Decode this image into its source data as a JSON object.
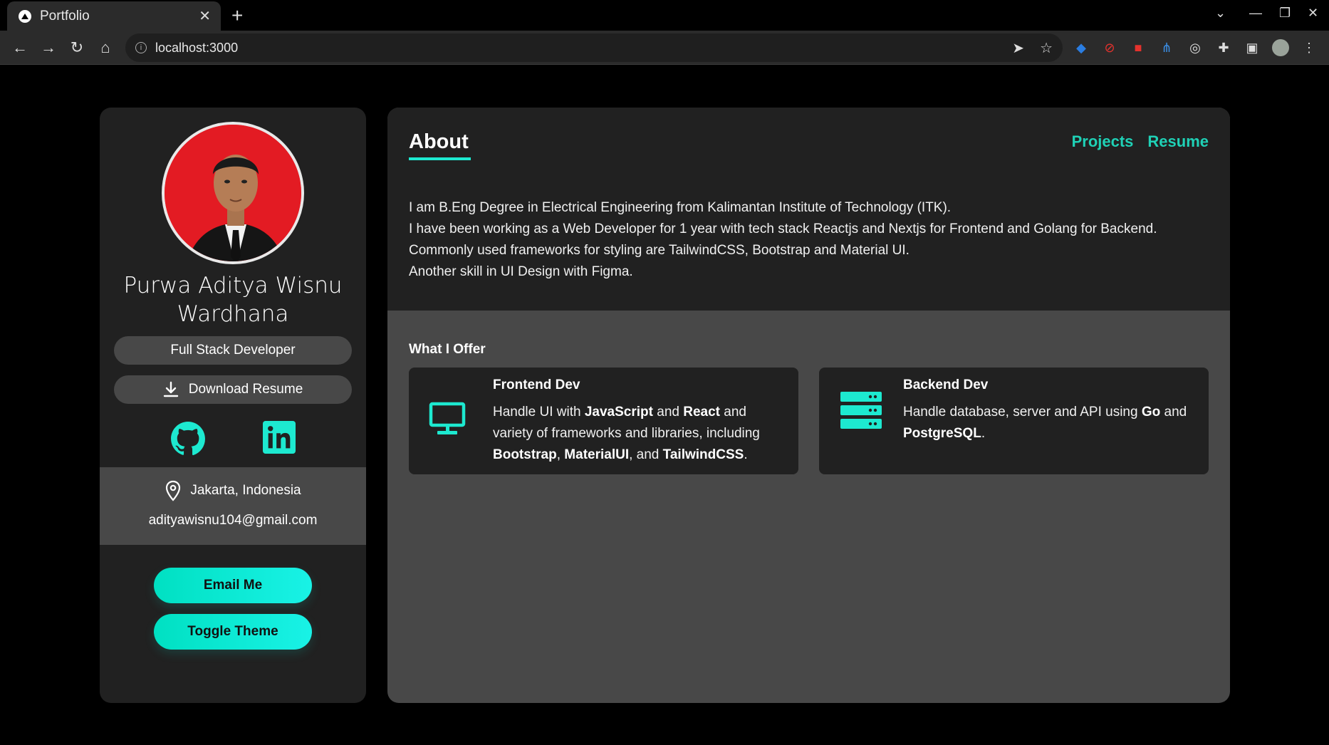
{
  "browser": {
    "tab_title": "Portfolio",
    "tab_close": "✕",
    "new_tab": "+",
    "url": "localhost:3000"
  },
  "profile": {
    "name": "Purwa Aditya Wisnu Wardhana",
    "role": "Full Stack Developer",
    "download_label": "Download Resume",
    "location": "Jakarta, Indonesia",
    "email": "adityawisnu104@gmail.com",
    "email_button": "Email Me",
    "theme_button": "Toggle Theme"
  },
  "nav": {
    "title": "About",
    "links": [
      "Projects",
      "Resume"
    ]
  },
  "about": {
    "lines": [
      "I am B.Eng Degree in Electrical Engineering from Kalimantan Institute of Technology (ITK).",
      "I have been working as a Web Developer for 1 year with tech stack Reactjs and Nextjs for Frontend and Golang for Backend.",
      "Commonly used frameworks for styling are TailwindCSS, Bootstrap and Material UI.",
      "Another skill in UI Design with Figma."
    ]
  },
  "offer": {
    "title": "What I Offer",
    "cards": [
      {
        "title": "Frontend Dev",
        "t1": "Handle UI with ",
        "b1": "JavaScript",
        "t2": " and ",
        "b2": "React",
        "t3": " and variety of frameworks and libraries, including ",
        "b3": "Bootstrap",
        "t4": ", ",
        "b4": "MaterialUI",
        "t5": ", and ",
        "b5": "TailwindCSS",
        "t6": "."
      },
      {
        "title": "Backend Dev",
        "t1": "Handle database, server and API using ",
        "b1": "Go",
        "t2": " and ",
        "b2": "PostgreSQL",
        "t3": "."
      }
    ]
  },
  "colors": {
    "accent": "#1de9d0",
    "link": "#1fd1b6",
    "panel": "#212121",
    "panel_alt": "#484848"
  }
}
